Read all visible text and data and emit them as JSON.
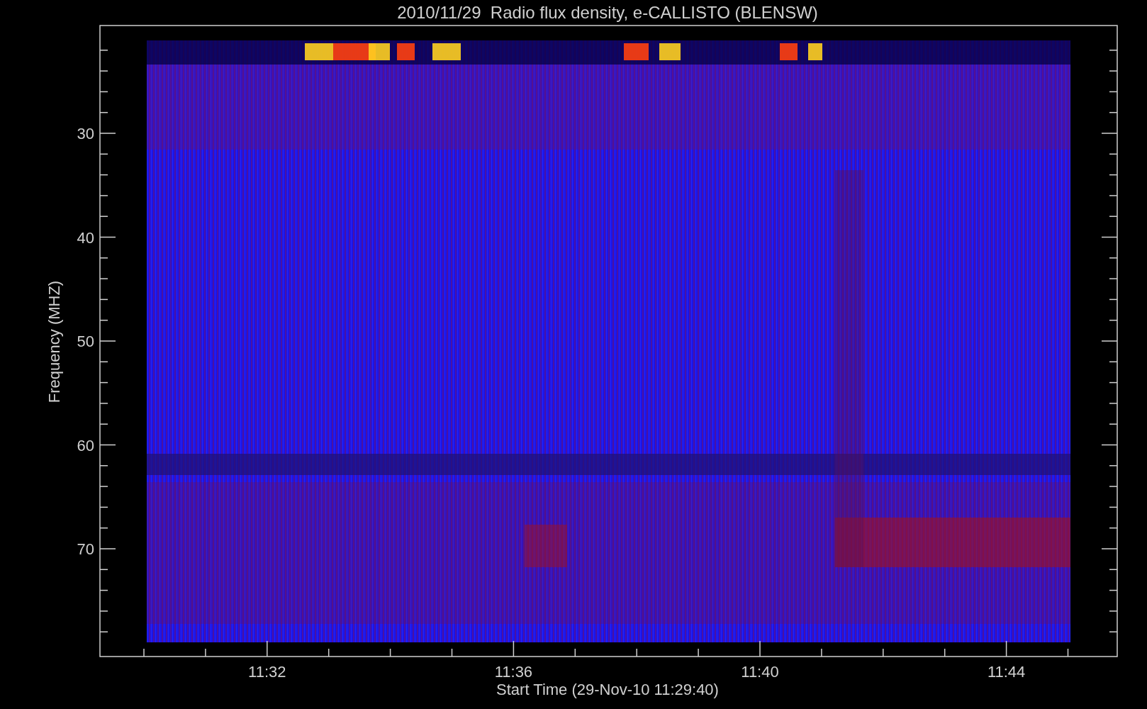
{
  "title": "2010/11/29  Radio flux density, e-CALLISTO (BLENSW)",
  "ylabel": "Frequency (MHZ)",
  "xlabel": "Start Time (29-Nov-10 11:29:40)",
  "yticks": [
    "30",
    "40",
    "50",
    "60",
    "70"
  ],
  "xticks": [
    "11:32",
    "11:36",
    "11:40",
    "11:44"
  ]
}
